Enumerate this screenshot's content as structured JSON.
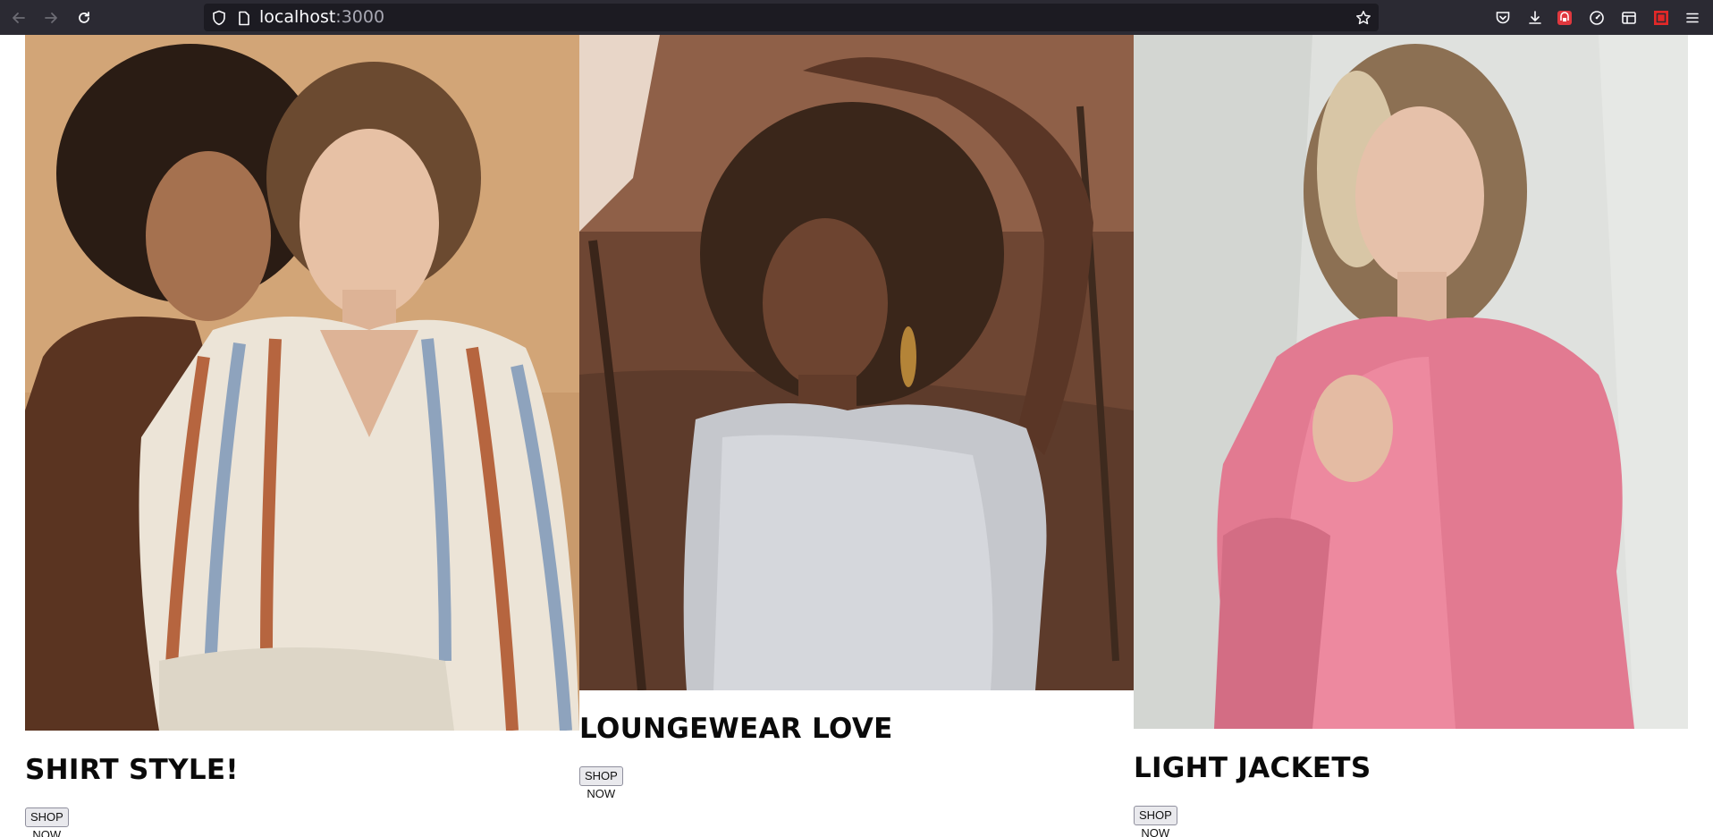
{
  "browser": {
    "url_host": "localhost",
    "url_port": ":3000"
  },
  "products": [
    {
      "title": "SHIRT STYLE!",
      "button_label": "SHOP NOW"
    },
    {
      "title": "LOUNGEWEAR LOVE",
      "button_label": "SHOP NOW"
    },
    {
      "title": "LIGHT JACKETS",
      "button_label": "SHOP NOW"
    }
  ],
  "colors": {
    "toolbar_bg": "#2b2a33",
    "urlbar_bg": "#1c1b22",
    "page_bg": "#ffffff",
    "title_text": "#0a0a0a"
  }
}
